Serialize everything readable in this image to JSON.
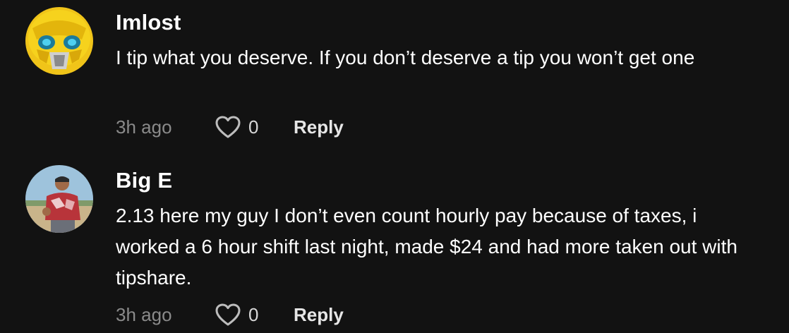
{
  "comments": [
    {
      "username": "Imlost",
      "text": "I tip what you deserve. If you don’t deserve a tip you won’t get one",
      "time": "3h ago",
      "likes": "0",
      "reply_label": "Reply",
      "avatar_icon": "yellow-robot-helmet-avatar"
    },
    {
      "username": "Big E",
      "text": "2.13 here my guy I don’t even count hourly pay because of taxes, i worked a 6 hour shift last night, made $24 and had more taken out with tipshare.",
      "time": "3h ago",
      "likes": "0",
      "reply_label": "Reply",
      "avatar_icon": "person-photo-avatar"
    }
  ],
  "colors": {
    "background": "#121212",
    "text": "#ffffff",
    "muted": "#8a8a8a"
  }
}
